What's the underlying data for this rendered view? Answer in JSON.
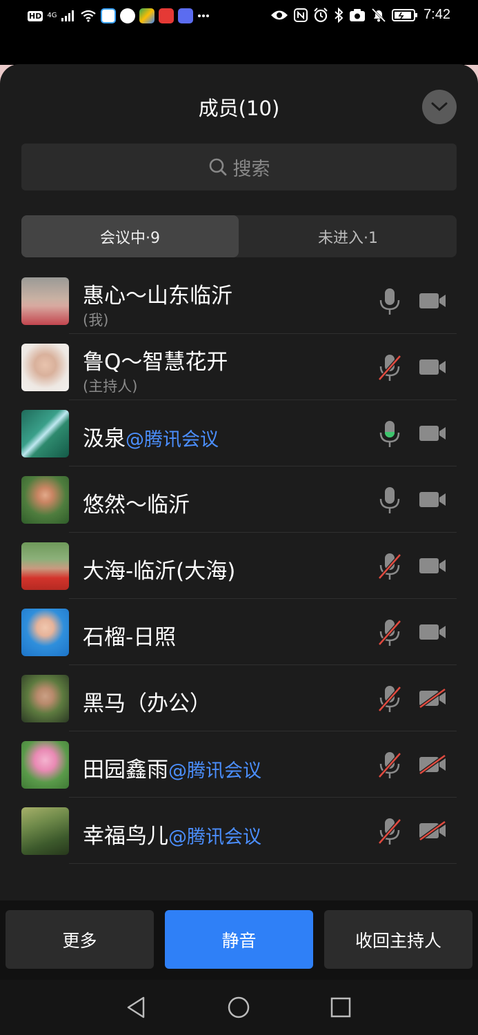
{
  "status_bar": {
    "hd_label": "HD",
    "network": "4G",
    "time": "7:42"
  },
  "header": {
    "title": "成员(10)"
  },
  "search": {
    "placeholder": "搜索"
  },
  "tabs": [
    {
      "label": "会议中·9",
      "active": true
    },
    {
      "label": "未进入·1",
      "active": false
    }
  ],
  "members": [
    {
      "name": "惠心～山东临沂",
      "tag": "",
      "role": "(我)",
      "mic": "on",
      "camera": "on"
    },
    {
      "name": "鲁Q～智慧花开",
      "tag": "",
      "role": "(主持人)",
      "mic": "muted",
      "camera": "on"
    },
    {
      "name": "汲泉",
      "tag": "@腾讯会议",
      "role": "",
      "mic": "speaking",
      "camera": "on"
    },
    {
      "name": "悠然～临沂",
      "tag": "",
      "role": "",
      "mic": "on",
      "camera": "on"
    },
    {
      "name": "大海-临沂(大海)",
      "tag": "",
      "role": "",
      "mic": "muted",
      "camera": "on"
    },
    {
      "name": "石榴-日照",
      "tag": "",
      "role": "",
      "mic": "muted",
      "camera": "on"
    },
    {
      "name": "黑马（办公）",
      "tag": "",
      "role": "",
      "mic": "muted",
      "camera": "off"
    },
    {
      "name": "田园鑫雨",
      "tag": "@腾讯会议",
      "role": "",
      "mic": "muted",
      "camera": "off"
    },
    {
      "name": "幸福鸟儿",
      "tag": "@腾讯会议",
      "role": "",
      "mic": "muted",
      "camera": "off"
    }
  ],
  "actions": {
    "more_label": "更多",
    "mute_label": "静音",
    "reclaim_host_label": "收回主持人"
  },
  "colors": {
    "accent": "#2f80f7",
    "tag_blue": "#4b8efc",
    "mute_red": "#e04a3f",
    "speaking_green": "#3ec46d"
  }
}
